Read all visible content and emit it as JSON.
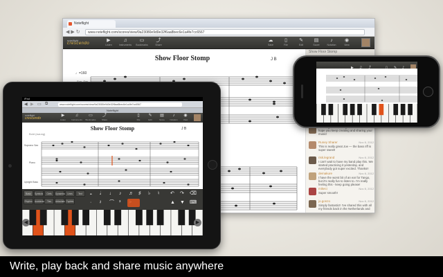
{
  "colors": {
    "accent_orange": "#e0531b",
    "toolbar_dark": "#3a3a37",
    "caption_bg": "#000000",
    "comment_name": "#c38a3f"
  },
  "browser": {
    "tab_title": "Noteflight",
    "url": "www.noteflight.com/scores/view/9a23080e9d0e32f6aa8bec6e1a4fe7cc6567",
    "logo_small": "noteflight",
    "logo_big": "crescendo",
    "toolbar_left": [
      {
        "icon": "play-icon",
        "label": "Listen"
      },
      {
        "icon": "instruments-icon",
        "label": "Instruments"
      },
      {
        "icon": "bookmark-icon",
        "label": "Bookmarks"
      },
      {
        "icon": "share-icon",
        "label": "Share"
      }
    ],
    "toolbar_right": [
      {
        "icon": "cloud-icon",
        "label": "Save"
      },
      {
        "icon": "file-icon",
        "label": "File"
      },
      {
        "icon": "edit-icon",
        "label": "Edit"
      },
      {
        "icon": "score-icon",
        "label": "Score"
      },
      {
        "icon": "notation-icon",
        "label": "Notation"
      },
      {
        "icon": "view-icon",
        "label": "View"
      }
    ]
  },
  "score": {
    "title": "Show Floor Stomp",
    "instruments": [
      "Soprano Sax",
      "Piano",
      "Upright Bass"
    ],
    "tempo": "♩=160",
    "composer": "J B"
  },
  "sidebar": {
    "header": "Show Floor Stomp",
    "comments": [
      {
        "name": "",
        "date": "",
        "text": "This might be coming back to mine — I hope you keep creating and sharing your music!",
        "avatar_color": "#8a7058"
      },
      {
        "name": "Runey Sharer",
        "date": "Nov 8, 2012",
        "text": "This is really great Joe — the bass riff is super sweet!",
        "avatar_color": "#b48a6c"
      },
      {
        "name": "risk.legrand",
        "date": "Nov 8, 2012",
        "text": "I can't wait to have my band play this. We started practicing it yesterday, and everybody got super excited. Thanks!!",
        "avatar_color": "#6b5a4a"
      },
      {
        "name": "demakure",
        "date": "Nov 8, 2012",
        "text": "I have the worst bit of an ear for Tango, but it's really fun to listen to. I'm really feeling this - keep going please!",
        "avatar_color": "#c0a27c"
      },
      {
        "name": "mikeci",
        "date": "Nov 8, 2012",
        "text": "Super smooth!",
        "avatar_color": "#a44"
      },
      {
        "name": "jo.gonzo",
        "date": "Nov 8, 2012",
        "text": "Simply fantastic!! I've shared this with all my friends back in the Netherlands and",
        "avatar_color": "#7b6650"
      }
    ]
  },
  "ipad": {
    "status": "iPad",
    "url": "www.noteflight.com/scores/view/9a23080e9d0e32f6aa8bec6e1a4fe7cc6567",
    "tab_title": "Noteflight",
    "score_title": "Show Floor Stomp",
    "composer": "J B",
    "subtitle": "Bold (swung)",
    "toolbar": [
      {
        "icon": "play-icon",
        "label": "Listen"
      },
      {
        "icon": "instruments-icon",
        "label": "Instruments"
      },
      {
        "icon": "bookmark-icon",
        "label": "Bookmarks"
      },
      {
        "icon": "share-icon",
        "label": "Share"
      },
      {
        "icon": "file-icon",
        "label": "File"
      },
      {
        "icon": "edit-icon",
        "label": "Edit"
      },
      {
        "icon": "score-icon",
        "label": "Score"
      },
      {
        "icon": "notation-icon",
        "label": "Notation"
      },
      {
        "icon": "view-icon",
        "label": "View"
      }
    ],
    "palette_tabs": [
      "Basic",
      "Symbols",
      "Clefs",
      "Dynamics",
      "Lines",
      "Text"
    ],
    "palette_tabs_row2": [
      "Rhythm",
      "Accidentals",
      "Ties",
      "Articulations",
      "Tuplets"
    ]
  },
  "caption": "Write, play back and share music anywhere"
}
